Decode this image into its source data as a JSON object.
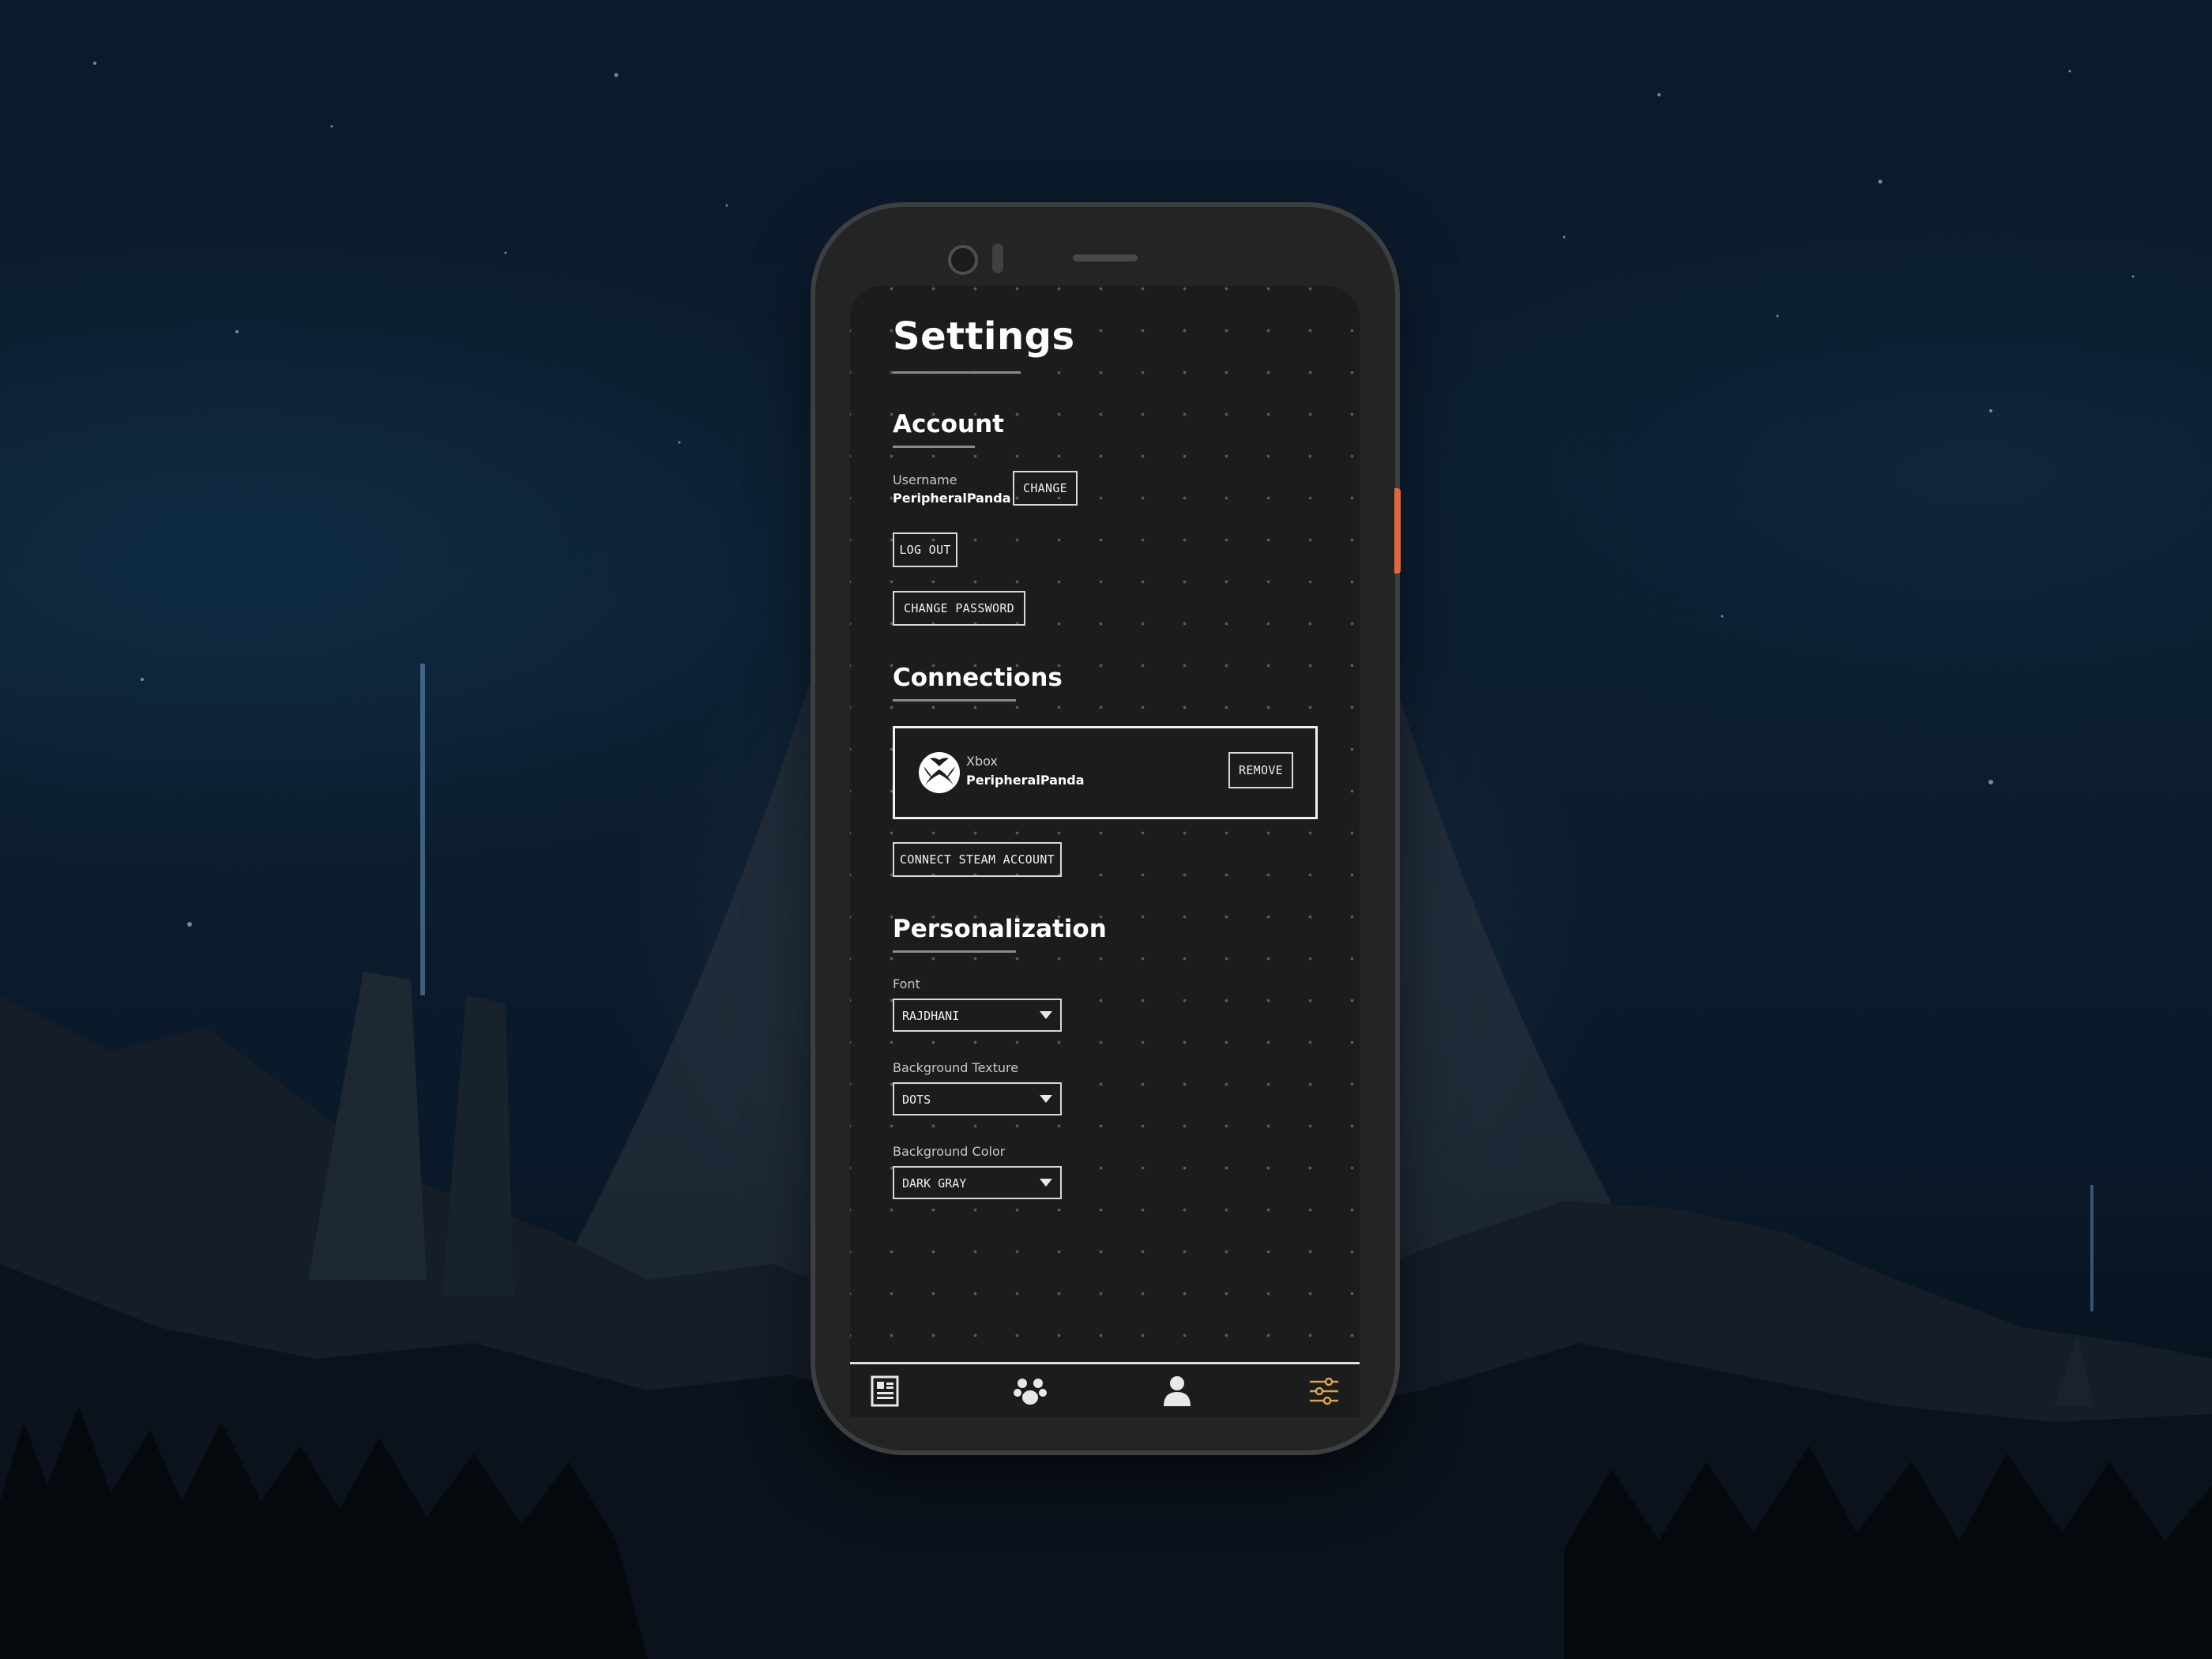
{
  "screen": {
    "title": "Settings"
  },
  "account": {
    "heading": "Account",
    "username_label": "Username",
    "username_value": "PeripheralPanda",
    "change_label": "CHANGE",
    "logout_label": "LOG OUT",
    "change_password_label": "CHANGE PASSWORD"
  },
  "connections": {
    "heading": "Connections",
    "items": [
      {
        "platform": "Xbox",
        "username": "PeripheralPanda",
        "icon": "xbox-icon",
        "remove_label": "REMOVE"
      }
    ],
    "connect_steam_label": "CONNECT STEAM ACCOUNT"
  },
  "personalization": {
    "heading": "Personalization",
    "font_label": "Font",
    "font_value": "RAJDHANI",
    "texture_label": "Background Texture",
    "texture_value": "DOTS",
    "color_label": "Background Color",
    "color_value": "DARK GRAY"
  },
  "nav": {
    "items": [
      {
        "icon": "news-icon",
        "active": false
      },
      {
        "icon": "group-icon",
        "active": false
      },
      {
        "icon": "profile-icon",
        "active": false
      },
      {
        "icon": "settings-sliders-icon",
        "active": true
      }
    ]
  },
  "colors": {
    "accent": "#e2673f",
    "active_nav": "#d9a44a",
    "screen_bg": "#1c1c1c",
    "text": "#ffffff"
  }
}
